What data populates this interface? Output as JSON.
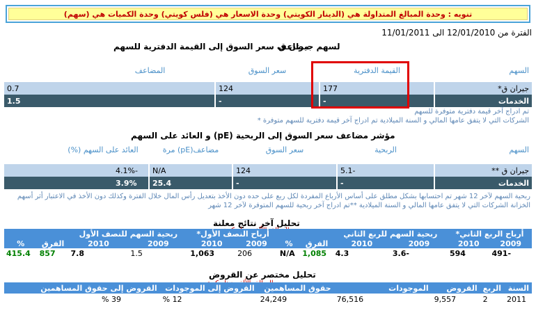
{
  "notice": "تنويه : وحدة المبالغ المتداولة هي (الدينار الكويتي) وحدة الاسعار هي (فلس كويتي) وحدة الكميات هي (سهم)",
  "period": "الفترة من 12/01/2010 الى 11/01/2011",
  "stock_label": "لسهم جيران ق",
  "section1": {
    "title": "مضاعف سعر السوق إلى القيمة الدفترية للسهم",
    "headers": [
      "السهم",
      "القيمة الدفترية",
      "سعر السوق",
      "المضاعف"
    ],
    "row": [
      "جيران ق*",
      "177",
      "124",
      "0.7"
    ],
    "sector": [
      "الخدمات",
      "-",
      "-",
      "1.5"
    ],
    "note1": "تم ادراج آخر قيمة دفترية متوفرة للسهم",
    "note2": "الشركات التي لا يتفق عامها المالي و السنة الميلادية تم ادراج آخر قيمة دفترية للسهم متوفرة *"
  },
  "section2": {
    "title": "مؤشر مضاعف سعر السوق إلى الربحية (pE) و العائد على السهم",
    "headers": [
      "السهم",
      "الربحية",
      "سعر السوق",
      "مضاعف(pE) مرة",
      "العائد على السهم (%)"
    ],
    "row": [
      "جيران ق **",
      "-5.1",
      "124",
      "N/A",
      "-4.1%"
    ],
    "sector": [
      "الخدمات",
      "-",
      "-",
      "25.4",
      "3.9%"
    ],
    "note": "ربحية السهم لآخر 12 شهر تم احتسابها بشكل مطلق على أساس الأرباع المفردة لكل ربع على حده دون الأخذ بتعديل رأس المال خلال الفترة وكذلك دون الأخذ في الاعتبار أثر أسهم الخزانة الشركات التي لا يتفق عامها المالي و السنة الميلادية **تم ادراج آخر ربحية للسهم المتوفرة لآخر 12 شهر"
  },
  "section3": {
    "title": "تحليل آخر نتائج معلنة",
    "subtitle": "- المبالغ بالألف دينار كويتي",
    "groups": [
      "أرباح الربع الثاني*",
      "ربحية السهم للربع الثاني",
      "أرباح النصف الأول*",
      "ربحية السهم للنصف الأول"
    ],
    "diff": "الفرق",
    "pct": "%",
    "years": [
      "2009",
      "2010"
    ],
    "values": {
      "q2_profit_2009": "-491",
      "q2_profit_2010": "594",
      "q2_eps_2009": "-3.6",
      "q2_eps_2010": "4.3",
      "q2_diff": "1,085",
      "q2_pct": "N/A",
      "h1_profit_2009": "206",
      "h1_profit_2010": "1,063",
      "h1_eps_2009": "1.5",
      "h1_eps_2010": "7.8",
      "h1_diff": "857",
      "h1_pct": "415.4"
    }
  },
  "section4": {
    "title": "تحليل مختصر عن القروض",
    "subtitle": "- المبالغ بالألف دينار كويتي",
    "headers": [
      "السنة",
      "الربع",
      "القروض",
      "الموجودات",
      "حقوق المساهمين",
      "القروض إلى الموجودات",
      "القروض إلى حقوق المساهمين"
    ],
    "row": [
      "2011",
      "2",
      "9,557",
      "76,516",
      "24,249",
      "12 %",
      "39 %"
    ]
  },
  "colors": {
    "header_blue": "#4a90d8",
    "row_light": "#bfd4ea",
    "row_dark": "#3a5a6a",
    "value_green": "#008000",
    "highlight_red": "#e00000"
  }
}
